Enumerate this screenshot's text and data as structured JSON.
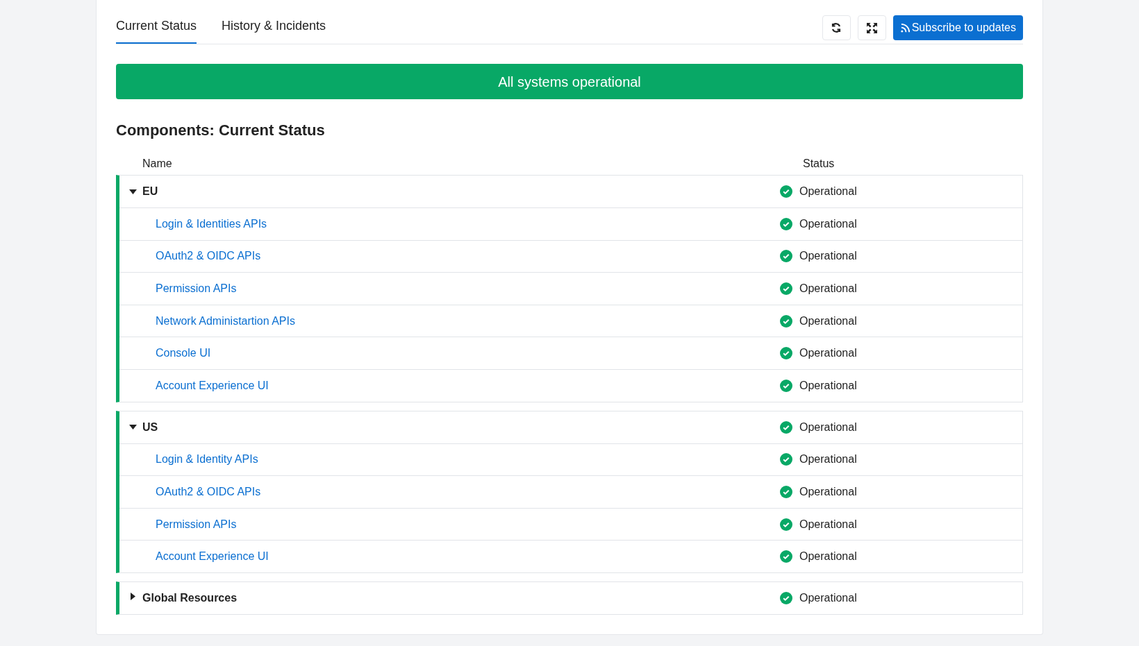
{
  "tabs": [
    {
      "label": "Current Status",
      "selected": true
    },
    {
      "label": "History & Incidents",
      "selected": false
    }
  ],
  "subscribe_button": "Subscribe to updates",
  "banner": "All systems operational",
  "heading": "Components: Current Status",
  "table": {
    "columns": [
      "Name",
      "Status"
    ],
    "groups": [
      {
        "name": "EU",
        "status": "Operational",
        "expanded": true,
        "children": [
          {
            "name": "Login & Identities APIs",
            "status": "Operational"
          },
          {
            "name": "OAuth2 & OIDC APIs",
            "status": "Operational"
          },
          {
            "name": "Permission APIs",
            "status": "Operational"
          },
          {
            "name": "Network Administartion APIs",
            "status": "Operational"
          },
          {
            "name": "Console UI",
            "status": "Operational"
          },
          {
            "name": "Account Experience UI",
            "status": "Operational"
          }
        ]
      },
      {
        "name": "US",
        "status": "Operational",
        "expanded": true,
        "children": [
          {
            "name": "Login & Identity APIs",
            "status": "Operational"
          },
          {
            "name": "OAuth2 & OIDC APIs",
            "status": "Operational"
          },
          {
            "name": "Permission APIs",
            "status": "Operational"
          },
          {
            "name": "Account Experience UI",
            "status": "Operational"
          }
        ]
      },
      {
        "name": "Global Resources",
        "status": "Operational",
        "expanded": false
      }
    ]
  }
}
